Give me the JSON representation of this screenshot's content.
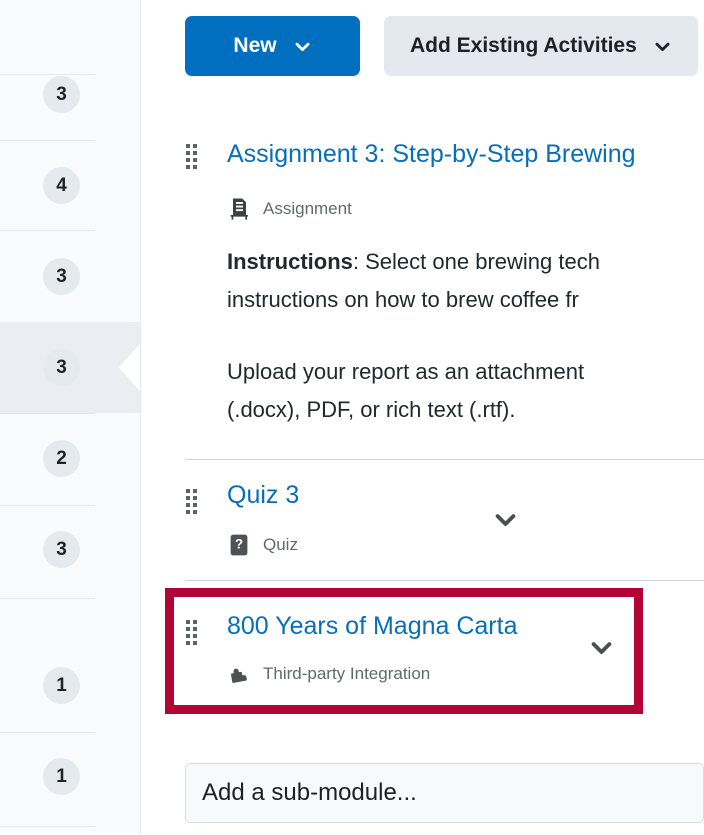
{
  "sidebar": {
    "rows": [
      {
        "badge": "3",
        "selected": false
      },
      {
        "badge": "4",
        "selected": false
      },
      {
        "badge": "3",
        "selected": false
      },
      {
        "badge": "3",
        "selected": true
      },
      {
        "badge": "2",
        "selected": false
      },
      {
        "badge": "3",
        "selected": false
      },
      {
        "badge": "1",
        "selected": false
      },
      {
        "badge": "1",
        "selected": false
      }
    ]
  },
  "toolbar": {
    "new_label": "New",
    "add_existing_label": "Add Existing Activities"
  },
  "content": {
    "items": [
      {
        "title": "Assignment 3: Step-by-Step Brewing",
        "type_label": "Assignment",
        "type_icon": "assignment-icon",
        "description_lines": [
          {
            "bold": "Instructions",
            "rest": ": Select one brewing tech"
          },
          {
            "bold": "",
            "rest": "instructions on how to brew coffee fr"
          },
          {
            "bold": "",
            "rest": "Upload your report as an attachment"
          },
          {
            "bold": "",
            "rest": "(.docx), PDF, or rich text (.rtf)."
          }
        ]
      },
      {
        "title": "Quiz 3",
        "type_label": "Quiz",
        "type_icon": "quiz-icon"
      },
      {
        "title": "800 Years of Magna Carta",
        "type_label": "Third-party Integration",
        "type_icon": "puzzle-piece-icon",
        "highlighted": true
      }
    ]
  },
  "footer": {
    "submodule_placeholder": "Add a sub-module..."
  },
  "colors": {
    "primary_button": "#006fbf",
    "link": "#066fbb",
    "highlight_border": "#b30436",
    "badge_bg": "#e5eaef",
    "secondary_button": "#e3e9ef"
  }
}
